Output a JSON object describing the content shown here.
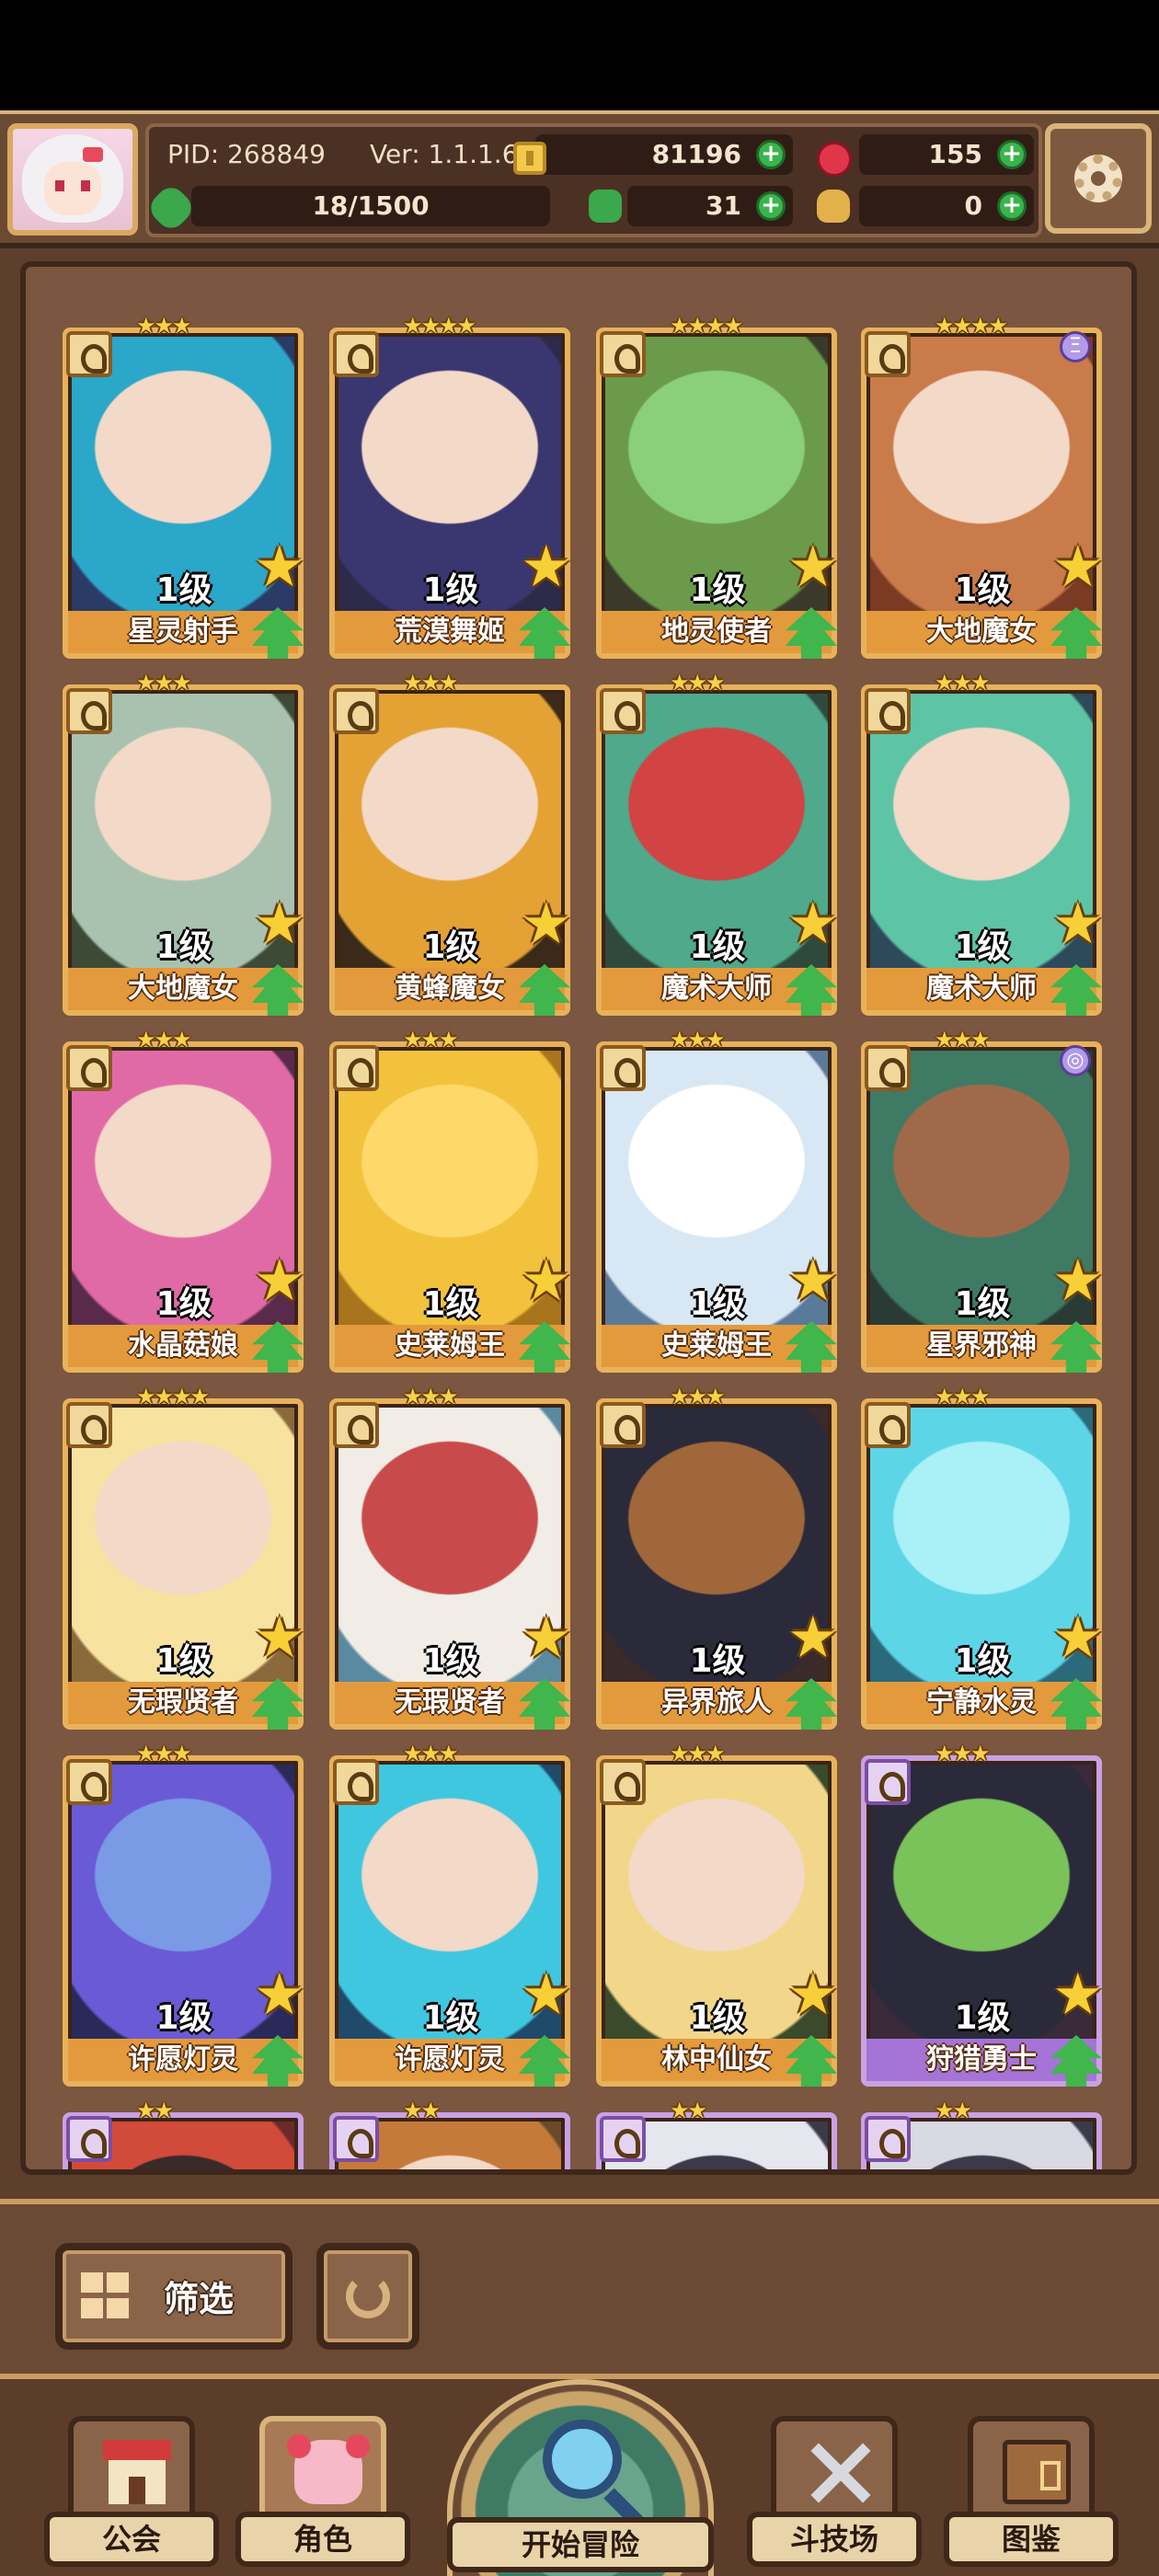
{
  "header": {
    "pid_label": "PID: 268849",
    "version_label": "Ver: 1.1.1.6",
    "gold": "81196",
    "gems": "155",
    "power": "18/1500",
    "clovers": "31",
    "tools": "0",
    "plus_symbol": "+"
  },
  "cards": [
    {
      "name": "星灵射手",
      "level": "1级",
      "stars": "★★★",
      "rarity": "gold"
    },
    {
      "name": "荒漠舞姬",
      "level": "1级",
      "stars": "★★★★",
      "rarity": "gold"
    },
    {
      "name": "地灵使者",
      "level": "1级",
      "stars": "★★★★",
      "rarity": "gold"
    },
    {
      "name": "大地魔女",
      "level": "1级",
      "stars": "★★★★",
      "rarity": "gold",
      "badge": "Ξ"
    },
    {
      "name": "大地魔女",
      "level": "1级",
      "stars": "★★★",
      "rarity": "gold"
    },
    {
      "name": "黄蜂魔女",
      "level": "1级",
      "stars": "★★★",
      "rarity": "gold"
    },
    {
      "name": "魔术大师",
      "level": "1级",
      "stars": "★★★",
      "rarity": "gold"
    },
    {
      "name": "魔术大师",
      "level": "1级",
      "stars": "★★★",
      "rarity": "gold"
    },
    {
      "name": "水晶菇娘",
      "level": "1级",
      "stars": "★★★",
      "rarity": "gold"
    },
    {
      "name": "史莱姆王",
      "level": "1级",
      "stars": "★★★",
      "rarity": "gold"
    },
    {
      "name": "史莱姆王",
      "level": "1级",
      "stars": "★★★",
      "rarity": "gold"
    },
    {
      "name": "星界邪神",
      "level": "1级",
      "stars": "★★★",
      "rarity": "gold",
      "badge": "◎"
    },
    {
      "name": "无瑕贤者",
      "level": "1级",
      "stars": "★★★★",
      "rarity": "gold"
    },
    {
      "name": "无瑕贤者",
      "level": "1级",
      "stars": "★★★",
      "rarity": "gold"
    },
    {
      "name": "异界旅人",
      "level": "1级",
      "stars": "★★★",
      "rarity": "gold"
    },
    {
      "name": "宁静水灵",
      "level": "1级",
      "stars": "★★★",
      "rarity": "gold"
    },
    {
      "name": "许愿灯灵",
      "level": "1级",
      "stars": "★★★",
      "rarity": "gold"
    },
    {
      "name": "许愿灯灵",
      "level": "1级",
      "stars": "★★★",
      "rarity": "gold"
    },
    {
      "name": "林中仙女",
      "level": "1级",
      "stars": "★★★",
      "rarity": "gold"
    },
    {
      "name": "狩猎勇士",
      "level": "1级",
      "stars": "★★★",
      "rarity": "purple"
    },
    {
      "name": "",
      "level": "",
      "stars": "★★",
      "rarity": "purple"
    },
    {
      "name": "",
      "level": "",
      "stars": "★★",
      "rarity": "purple"
    },
    {
      "name": "",
      "level": "",
      "stars": "★★",
      "rarity": "purple"
    },
    {
      "name": "",
      "level": "",
      "stars": "★★",
      "rarity": "purple"
    }
  ],
  "toolbar": {
    "filter_label": "筛选"
  },
  "nav": {
    "guild": "公会",
    "character": "角色",
    "adventure": "开始冒险",
    "arena": "斗技场",
    "codex": "图鉴"
  },
  "colors": {
    "card_gold": "#e8b25a",
    "card_purple": "#c9a1e4",
    "plus_green": "#3ab44c"
  }
}
